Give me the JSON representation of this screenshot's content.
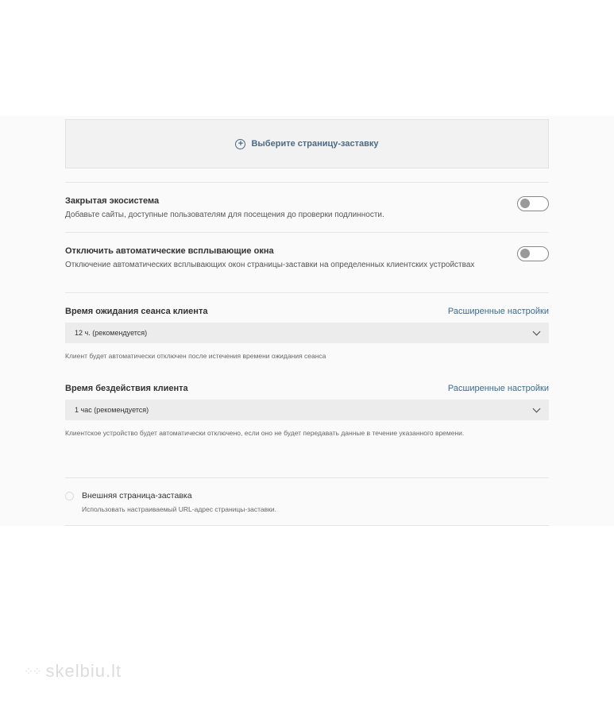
{
  "splash": {
    "label": "Выберите страницу-заставку",
    "icon": "plus-circle-icon"
  },
  "closed_ecosystem": {
    "title": "Закрытая экосистема",
    "description": "Добавьте сайты, доступные пользователям для посещения до проверки подлинности.",
    "enabled": false
  },
  "disable_popups": {
    "title": "Отключить автоматические всплывающие окна",
    "description": "Отключение автоматических всплывающих окон страницы-заставки на определенных клиентских устройствах",
    "enabled": false
  },
  "session_timeout": {
    "title": "Время ожидания сеанса клиента",
    "advanced_link": "Расширенные настройки",
    "selected": "12 ч. (рекомендуется)",
    "hint": "Клиент будет автоматически отключен после истечения времени ожидания сеанса"
  },
  "idle_timeout": {
    "title": "Время бездействия клиента",
    "advanced_link": "Расширенные настройки",
    "selected": "1 час (рекомендуется)",
    "hint": "Клиентское устройство будет автоматически отключено, если оно не будет передавать данные в течение указанного времени."
  },
  "external_splash": {
    "title": "Внешняя страница-заставка",
    "description": "Использовать настраиваемый URL-адрес страницы-заставки."
  },
  "watermark": {
    "text": "skelbiu.lt"
  }
}
